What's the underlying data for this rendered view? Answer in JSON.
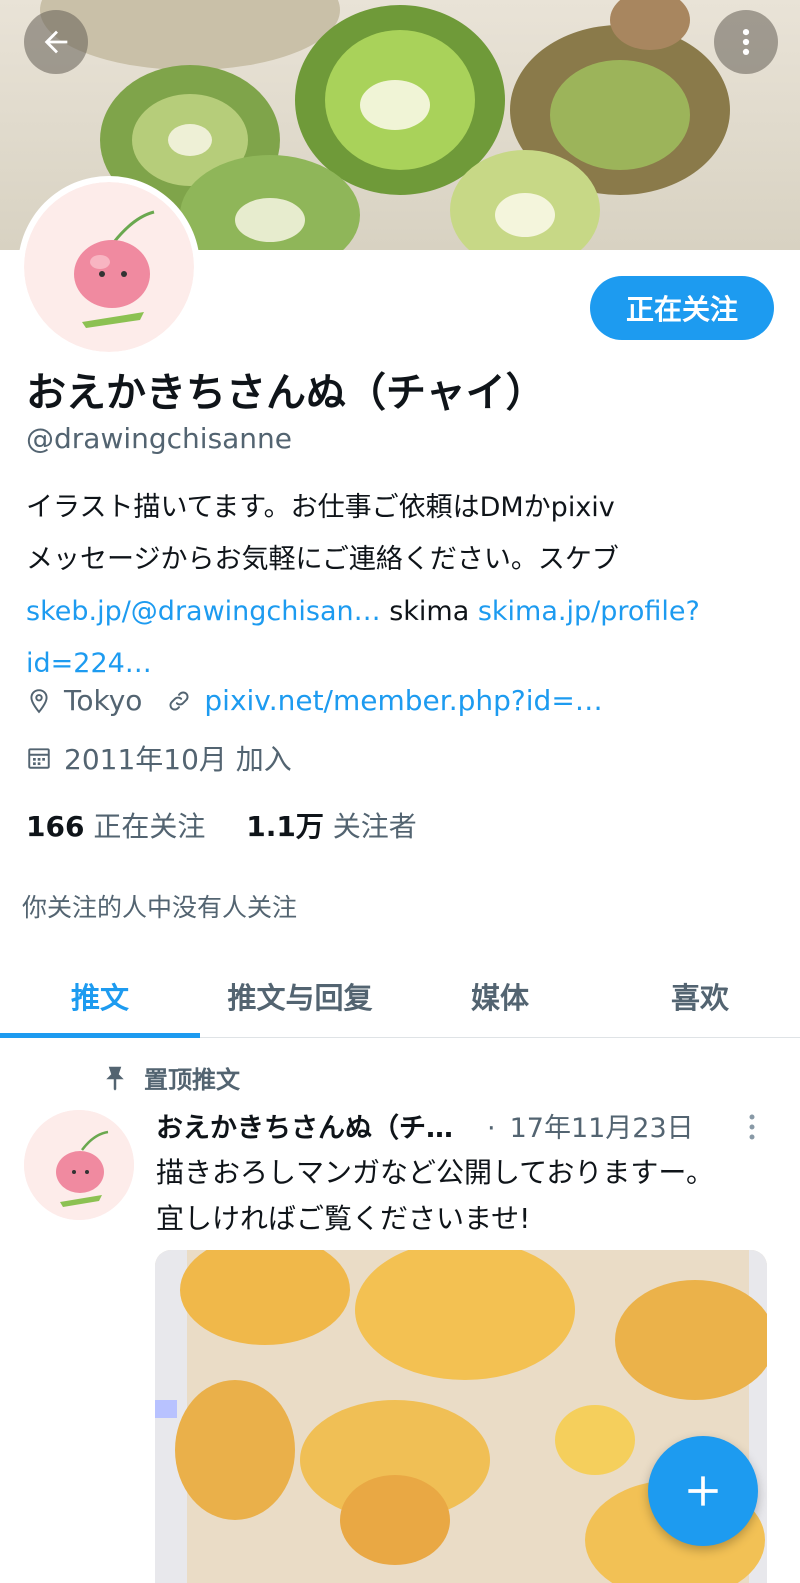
{
  "header": {
    "back_icon": "arrow-left-icon",
    "more_icon": "more-vertical-icon"
  },
  "profile": {
    "display_name": "おえかきちさんぬ（チャイ）",
    "handle": "@drawingchisanne",
    "follow_button": "正在关注",
    "bio": {
      "line1": "イラスト描いてます。お仕事ご依頼はDMかpixiv",
      "line2": "メッセージからお気軽にご連絡ください。スケブ",
      "link1": "skeb.jp/@drawingchisan…",
      "text_mid": " skima ",
      "link2a": "skima.jp/profile?",
      "link2b": "id=224…"
    },
    "location": "Tokyo",
    "website": "pixiv.net/member.php?id=…",
    "joined": "2011年10月 加入",
    "following_count": "166",
    "following_label": "正在关注",
    "followers_count": "1.1万",
    "followers_label": "关注者",
    "mutual_note": "你关注的人中没有人关注"
  },
  "tabs": [
    {
      "label": "推文",
      "active": true
    },
    {
      "label": "推文与回复",
      "active": false
    },
    {
      "label": "媒体",
      "active": false
    },
    {
      "label": "喜欢",
      "active": false
    }
  ],
  "tweet": {
    "pinned_label": "置顶推文",
    "author": "おえかきちさんぬ（チ…",
    "separator": "·",
    "date": "17年11月23日",
    "text_line1": "描きおろしマンガなど公開しておりますー。",
    "text_line2": "宜しければご覧くださいませ!"
  },
  "colors": {
    "accent": "#1d9bf0",
    "secondary_text": "#536471"
  }
}
